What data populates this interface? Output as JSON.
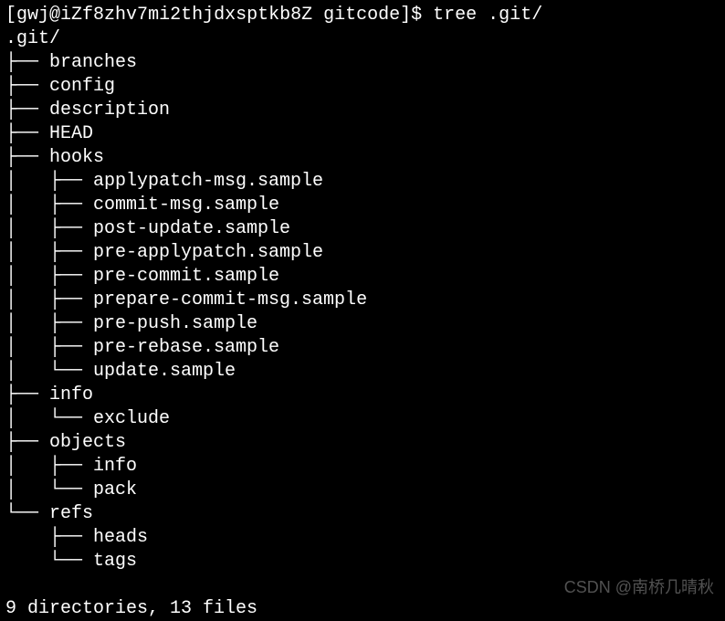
{
  "prompt": {
    "user": "gwj",
    "host": "iZf8zhv7mi2thjdxsptkb8Z",
    "cwd": "gitcode",
    "symbol": "$",
    "command": "tree .git/"
  },
  "tree": {
    "root": ".git/",
    "lines": [
      "├── branches",
      "├── config",
      "├── description",
      "├── HEAD",
      "├── hooks",
      "│   ├── applypatch-msg.sample",
      "│   ├── commit-msg.sample",
      "│   ├── post-update.sample",
      "│   ├── pre-applypatch.sample",
      "│   ├── pre-commit.sample",
      "│   ├── prepare-commit-msg.sample",
      "│   ├── pre-push.sample",
      "│   ├── pre-rebase.sample",
      "│   └── update.sample",
      "├── info",
      "│   └── exclude",
      "├── objects",
      "│   ├── info",
      "│   └── pack",
      "└── refs",
      "    ├── heads",
      "    └── tags"
    ]
  },
  "summary": "9 directories, 13 files",
  "watermark": "CSDN @南桥几晴秋"
}
